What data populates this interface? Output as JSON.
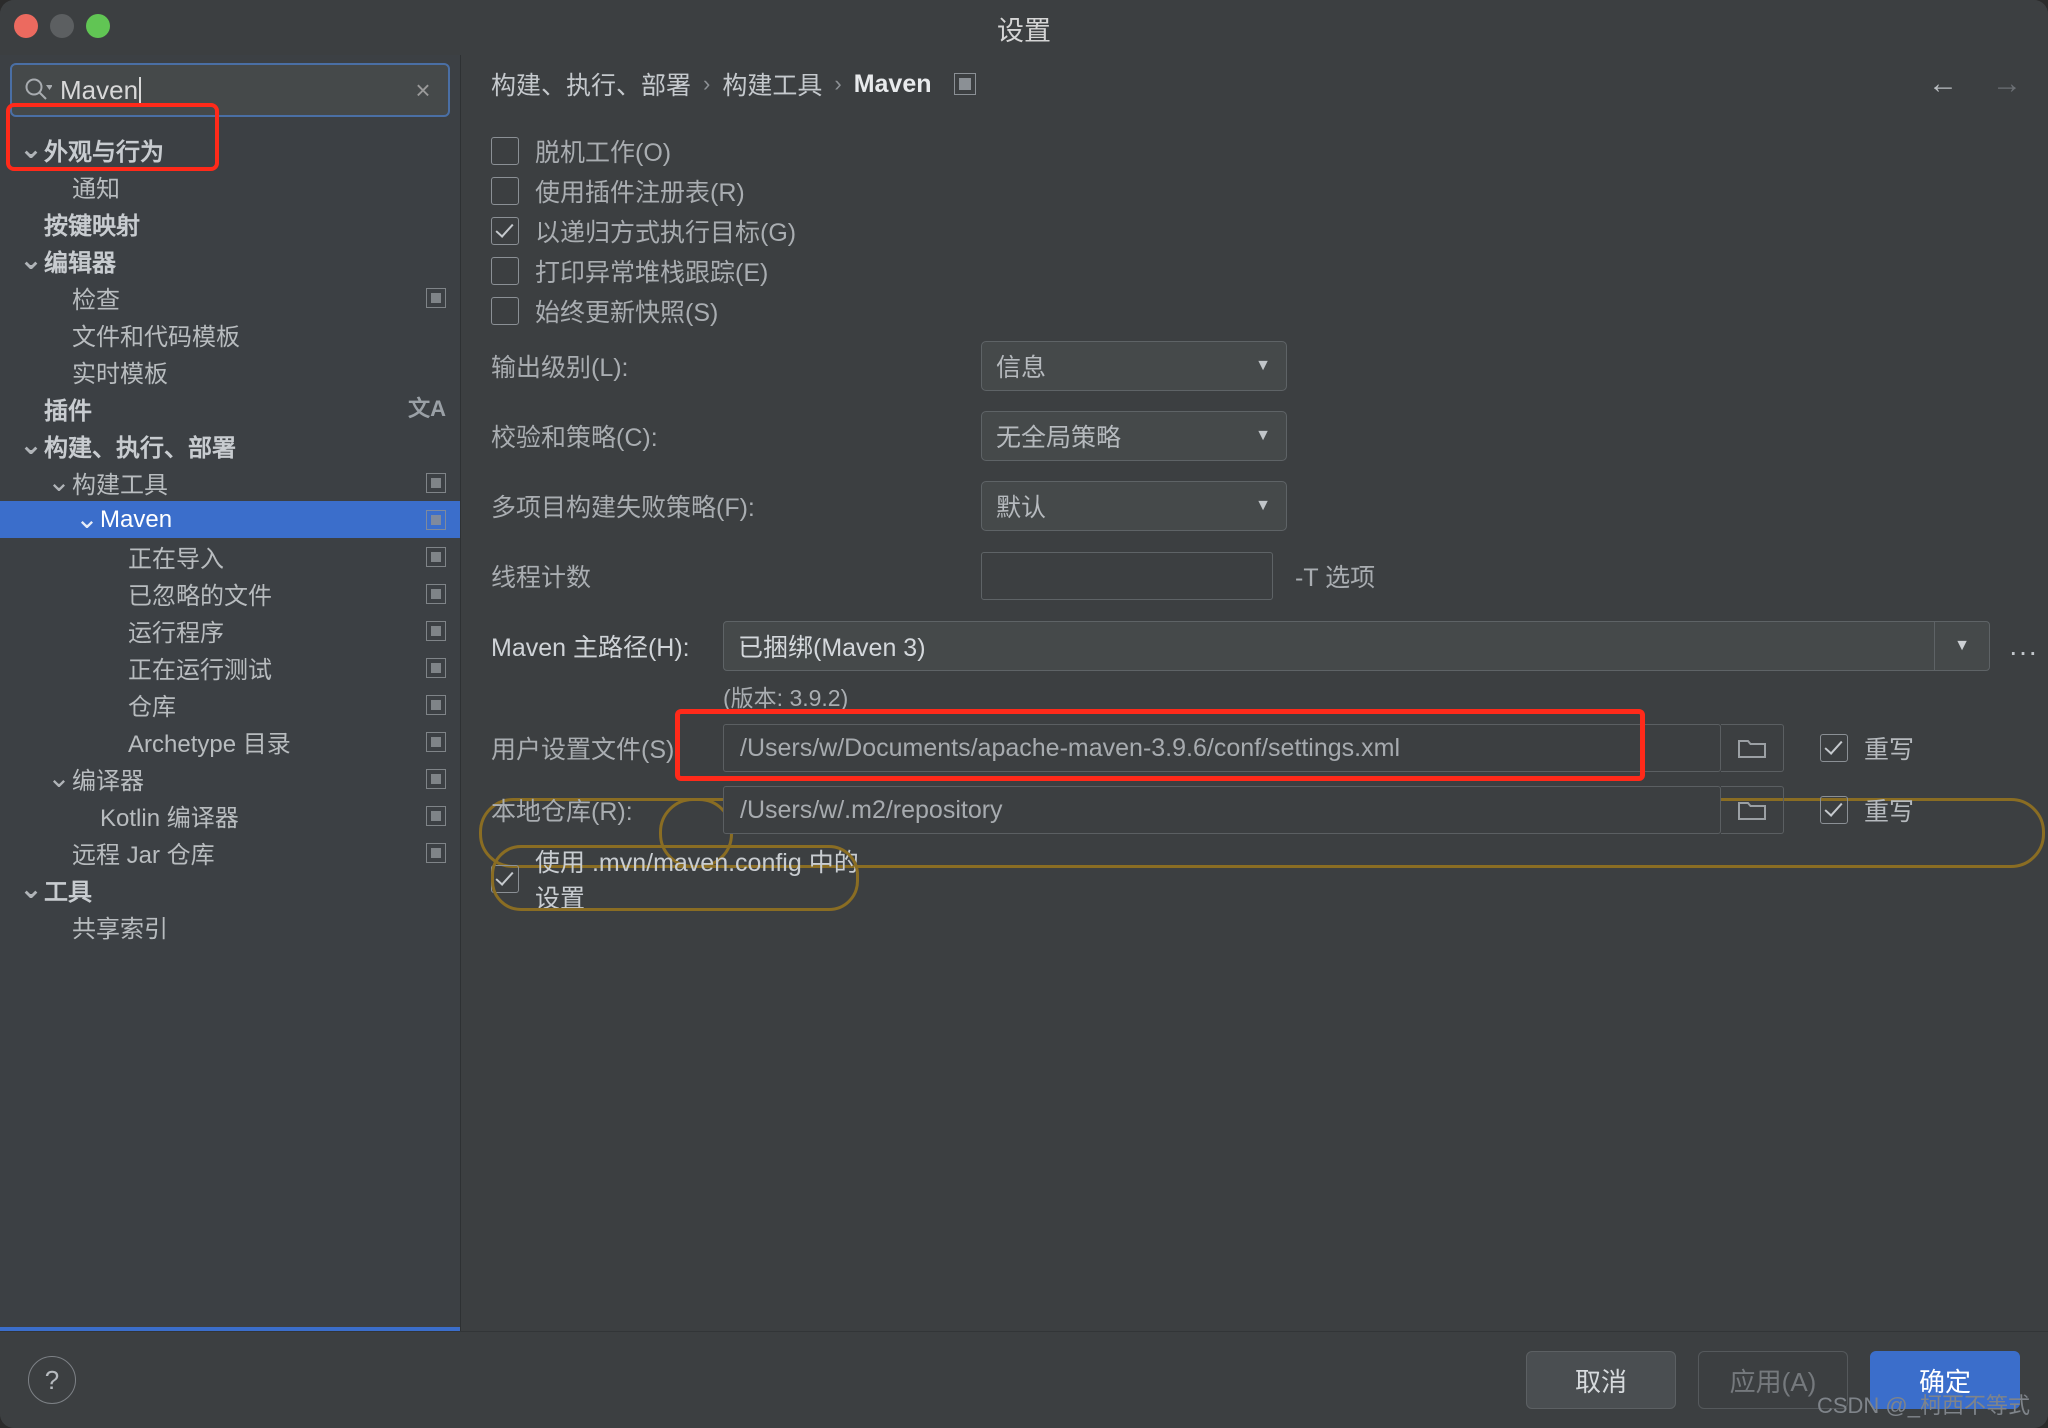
{
  "window": {
    "title": "设置",
    "traffic_lights": [
      "close-red",
      "minimize-gray",
      "zoom-green"
    ]
  },
  "search": {
    "value": "Maven",
    "icon": "search-icon",
    "clear_icon": "×"
  },
  "sidebar": {
    "items": [
      {
        "label": "外观与行为",
        "indent": 0,
        "chevron": "v",
        "bold": true,
        "mark": false,
        "selected": false
      },
      {
        "label": "通知",
        "indent": 1,
        "chevron": "",
        "bold": false,
        "mark": false,
        "selected": false
      },
      {
        "label": "按键映射",
        "indent": 0,
        "chevron": "",
        "bold": true,
        "mark": false,
        "selected": false
      },
      {
        "label": "编辑器",
        "indent": 0,
        "chevron": "v",
        "bold": true,
        "mark": false,
        "selected": false
      },
      {
        "label": "检查",
        "indent": 1,
        "chevron": "",
        "bold": false,
        "mark": true,
        "selected": false
      },
      {
        "label": "文件和代码模板",
        "indent": 1,
        "chevron": "",
        "bold": false,
        "mark": false,
        "selected": false
      },
      {
        "label": "实时模板",
        "indent": 1,
        "chevron": "",
        "bold": false,
        "mark": false,
        "selected": false
      },
      {
        "label": "插件",
        "indent": 0,
        "chevron": "",
        "bold": true,
        "mark": false,
        "selected": false,
        "lang": true
      },
      {
        "label": "构建、执行、部署",
        "indent": 0,
        "chevron": "v",
        "bold": true,
        "mark": false,
        "selected": false
      },
      {
        "label": "构建工具",
        "indent": 1,
        "chevron": "v",
        "bold": false,
        "mark": true,
        "selected": false
      },
      {
        "label": "Maven",
        "indent": 2,
        "chevron": "v",
        "bold": false,
        "mark": true,
        "selected": true
      },
      {
        "label": "正在导入",
        "indent": 3,
        "chevron": "",
        "bold": false,
        "mark": true,
        "selected": false
      },
      {
        "label": "已忽略的文件",
        "indent": 3,
        "chevron": "",
        "bold": false,
        "mark": true,
        "selected": false
      },
      {
        "label": "运行程序",
        "indent": 3,
        "chevron": "",
        "bold": false,
        "mark": true,
        "selected": false
      },
      {
        "label": "正在运行测试",
        "indent": 3,
        "chevron": "",
        "bold": false,
        "mark": true,
        "selected": false
      },
      {
        "label": "仓库",
        "indent": 3,
        "chevron": "",
        "bold": false,
        "mark": true,
        "selected": false
      },
      {
        "label": "Archetype 目录",
        "indent": 3,
        "chevron": "",
        "bold": false,
        "mark": true,
        "selected": false
      },
      {
        "label": "编译器",
        "indent": 1,
        "chevron": "v",
        "bold": false,
        "mark": true,
        "selected": false
      },
      {
        "label": "Kotlin 编译器",
        "indent": 2,
        "chevron": "",
        "bold": false,
        "mark": true,
        "selected": false
      },
      {
        "label": "远程 Jar 仓库",
        "indent": 1,
        "chevron": "",
        "bold": false,
        "mark": true,
        "selected": false
      },
      {
        "label": "工具",
        "indent": 0,
        "chevron": "v",
        "bold": true,
        "mark": false,
        "selected": false
      },
      {
        "label": "共享索引",
        "indent": 1,
        "chevron": "",
        "bold": false,
        "mark": false,
        "selected": false
      }
    ]
  },
  "breadcrumb": {
    "items": [
      "构建、执行、部署",
      "构建工具",
      "Maven"
    ],
    "separator": "›",
    "back_arrow": "←",
    "forward_arrow": "→"
  },
  "main": {
    "checkboxes": [
      {
        "label": "脱机工作(O)",
        "checked": false
      },
      {
        "label": "使用插件注册表(R)",
        "checked": false
      },
      {
        "label": "以递归方式执行目标(G)",
        "checked": true
      },
      {
        "label": "打印异常堆栈跟踪(E)",
        "checked": false
      },
      {
        "label": "始终更新快照(S)",
        "checked": false
      }
    ],
    "fields": [
      {
        "label": "输出级别(L):",
        "value": "信息",
        "kind": "combo"
      },
      {
        "label": "校验和策略(C):",
        "value": "无全局策略",
        "kind": "combo"
      },
      {
        "label": "多项目构建失败策略(F):",
        "value": "默认",
        "kind": "combo"
      },
      {
        "label": "线程计数",
        "value": "",
        "kind": "text",
        "suffix": "-T 选项"
      }
    ],
    "maven_home": {
      "label": "Maven 主路径(H):",
      "value": "已捆绑(Maven 3)",
      "ellipsis": "...",
      "version_note": "(版本: 3.9.2)"
    },
    "user_settings": {
      "label": "用户设置文件(S):",
      "value": "/Users/w/Documents/apache-maven-3.9.6/conf/settings.xml",
      "override_label": "重写",
      "override_checked": true
    },
    "local_repo": {
      "label": "本地仓库(R):",
      "value": "/Users/w/.m2/repository",
      "override_label": "重写",
      "override_checked": true
    },
    "mvn_config": {
      "label": "使用 .mvn/maven.config 中的设置",
      "checked": true
    }
  },
  "footer": {
    "help": "?",
    "cancel": "取消",
    "apply": "应用(A)",
    "ok": "确定"
  },
  "watermark": "CSDN @_柯西不等式",
  "colors": {
    "accent": "#3b6ecb",
    "highlight_red": "#ff2a1a",
    "highlight_gold": "#8a6d23",
    "window_bg": "#3c3f41",
    "sidebar_bg": "#3c4044"
  }
}
